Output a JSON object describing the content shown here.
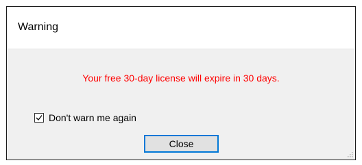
{
  "dialog": {
    "title": "Warning",
    "message": "Your free 30-day license will expire in 30 days.",
    "message_color": "#ff0000",
    "checkbox": {
      "label": "Don't warn me again",
      "checked": true
    },
    "close_label": "Close",
    "accent_color": "#0078d7"
  },
  "icons": {
    "checkbox_mark": "checkmark-icon",
    "resize": "resize-grip-icon"
  }
}
